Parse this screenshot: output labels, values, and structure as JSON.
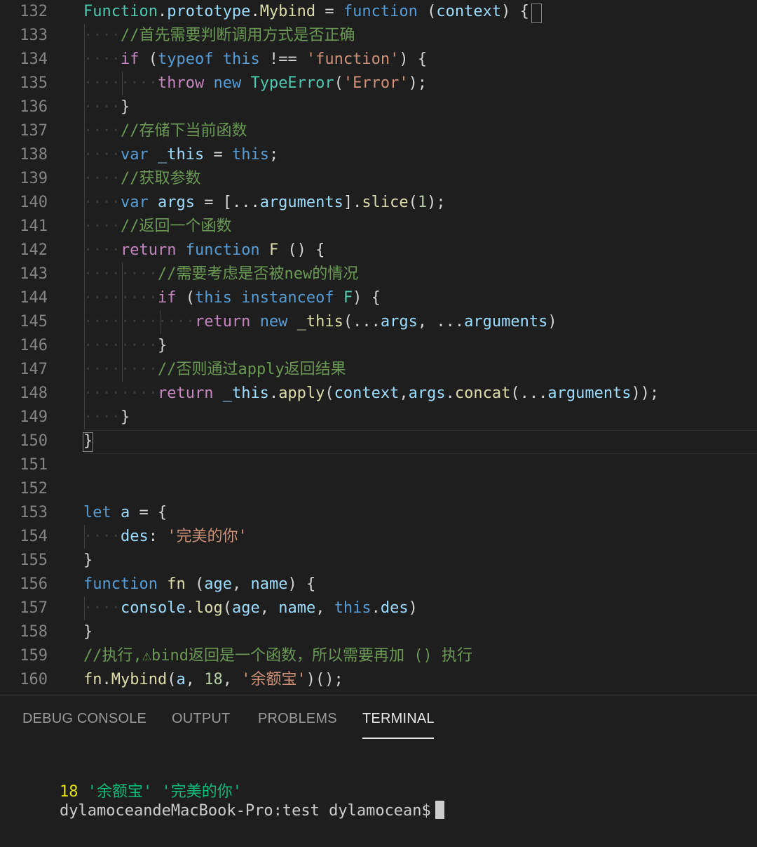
{
  "editor": {
    "lines": [
      {
        "n": "132",
        "tokens": [
          [
            "Function",
            "t-cls"
          ],
          [
            ".",
            "t-op"
          ],
          [
            "prototype",
            "t-var"
          ],
          [
            ".",
            "t-op"
          ],
          [
            "Mybind",
            "t-fn"
          ],
          [
            " = ",
            "t-op"
          ],
          [
            "function",
            "t-kw"
          ],
          [
            " (",
            "t-op"
          ],
          [
            "context",
            "t-var"
          ],
          [
            ") ",
            "t-op"
          ],
          [
            "{",
            "t-op"
          ]
        ]
      },
      {
        "n": "133",
        "tokens": [
          [
            "····",
            "ws"
          ],
          [
            "//首先需要判断调用方式是否正确",
            "t-com"
          ]
        ]
      },
      {
        "n": "134",
        "tokens": [
          [
            "····",
            "ws"
          ],
          [
            "if",
            "t-ctl"
          ],
          [
            " (",
            "t-op"
          ],
          [
            "typeof",
            "t-kw"
          ],
          [
            " ",
            "t-op"
          ],
          [
            "this",
            "t-kw"
          ],
          [
            " !== ",
            "t-op"
          ],
          [
            "'function'",
            "t-str"
          ],
          [
            ") {",
            "t-op"
          ]
        ]
      },
      {
        "n": "135",
        "tokens": [
          [
            "········",
            "ws"
          ],
          [
            "throw",
            "t-ctl"
          ],
          [
            " ",
            "t-op"
          ],
          [
            "new",
            "t-kw"
          ],
          [
            " ",
            "t-op"
          ],
          [
            "TypeError",
            "t-cls"
          ],
          [
            "(",
            "t-op"
          ],
          [
            "'Error'",
            "t-str"
          ],
          [
            ");",
            "t-op"
          ]
        ]
      },
      {
        "n": "136",
        "tokens": [
          [
            "····",
            "ws"
          ],
          [
            "}",
            "t-op"
          ]
        ]
      },
      {
        "n": "137",
        "tokens": [
          [
            "····",
            "ws"
          ],
          [
            "//存储下当前函数",
            "t-com"
          ]
        ]
      },
      {
        "n": "138",
        "tokens": [
          [
            "····",
            "ws"
          ],
          [
            "var",
            "t-kw"
          ],
          [
            " ",
            "t-op"
          ],
          [
            "_this",
            "t-var"
          ],
          [
            " = ",
            "t-op"
          ],
          [
            "this",
            "t-kw"
          ],
          [
            ";",
            "t-op"
          ]
        ]
      },
      {
        "n": "139",
        "tokens": [
          [
            "····",
            "ws"
          ],
          [
            "//获取参数",
            "t-com"
          ]
        ]
      },
      {
        "n": "140",
        "tokens": [
          [
            "····",
            "ws"
          ],
          [
            "var",
            "t-kw"
          ],
          [
            " ",
            "t-op"
          ],
          [
            "args",
            "t-var"
          ],
          [
            " = [...",
            "t-op"
          ],
          [
            "arguments",
            "t-var"
          ],
          [
            "].",
            "t-op"
          ],
          [
            "slice",
            "t-fn"
          ],
          [
            "(",
            "t-op"
          ],
          [
            "1",
            "t-num"
          ],
          [
            ");",
            "t-op"
          ]
        ]
      },
      {
        "n": "141",
        "tokens": [
          [
            "····",
            "ws"
          ],
          [
            "//返回一个函数",
            "t-com"
          ]
        ]
      },
      {
        "n": "142",
        "tokens": [
          [
            "····",
            "ws"
          ],
          [
            "return",
            "t-ctl"
          ],
          [
            " ",
            "t-op"
          ],
          [
            "function",
            "t-kw"
          ],
          [
            " ",
            "t-op"
          ],
          [
            "F",
            "t-fn"
          ],
          [
            " () {",
            "t-op"
          ]
        ]
      },
      {
        "n": "143",
        "tokens": [
          [
            "········",
            "ws"
          ],
          [
            "//需要考虑是否被new的情况",
            "t-com"
          ]
        ]
      },
      {
        "n": "144",
        "tokens": [
          [
            "········",
            "ws"
          ],
          [
            "if",
            "t-ctl"
          ],
          [
            " (",
            "t-op"
          ],
          [
            "this",
            "t-kw"
          ],
          [
            " ",
            "t-op"
          ],
          [
            "instanceof",
            "t-kw"
          ],
          [
            " ",
            "t-op"
          ],
          [
            "F",
            "t-cls"
          ],
          [
            ") {",
            "t-op"
          ]
        ]
      },
      {
        "n": "145",
        "tokens": [
          [
            "············",
            "ws"
          ],
          [
            "return",
            "t-ctl"
          ],
          [
            " ",
            "t-op"
          ],
          [
            "new",
            "t-kw"
          ],
          [
            " ",
            "t-op"
          ],
          [
            "_this",
            "t-fn"
          ],
          [
            "(...",
            "t-op"
          ],
          [
            "args",
            "t-var"
          ],
          [
            ", ...",
            "t-op"
          ],
          [
            "arguments",
            "t-var"
          ],
          [
            ")",
            "t-op"
          ]
        ]
      },
      {
        "n": "146",
        "tokens": [
          [
            "········",
            "ws"
          ],
          [
            "}",
            "t-op"
          ]
        ]
      },
      {
        "n": "147",
        "tokens": [
          [
            "········",
            "ws"
          ],
          [
            "//否则通过apply返回结果",
            "t-com"
          ]
        ]
      },
      {
        "n": "148",
        "tokens": [
          [
            "········",
            "ws"
          ],
          [
            "return",
            "t-ctl"
          ],
          [
            " ",
            "t-op"
          ],
          [
            "_this",
            "t-var"
          ],
          [
            ".",
            "t-op"
          ],
          [
            "apply",
            "t-fn"
          ],
          [
            "(",
            "t-op"
          ],
          [
            "context",
            "t-var"
          ],
          [
            ",",
            "t-op"
          ],
          [
            "args",
            "t-var"
          ],
          [
            ".",
            "t-op"
          ],
          [
            "concat",
            "t-fn"
          ],
          [
            "(...",
            "t-op"
          ],
          [
            "arguments",
            "t-var"
          ],
          [
            "));",
            "t-op"
          ]
        ]
      },
      {
        "n": "149",
        "tokens": [
          [
            "····",
            "ws"
          ],
          [
            "}",
            "t-op"
          ]
        ]
      },
      {
        "n": "150",
        "tokens": [
          [
            "}",
            "t-op"
          ]
        ]
      },
      {
        "n": "151",
        "tokens": []
      },
      {
        "n": "152",
        "tokens": []
      },
      {
        "n": "153",
        "tokens": [
          [
            "let",
            "t-kw"
          ],
          [
            " ",
            "t-op"
          ],
          [
            "a",
            "t-var"
          ],
          [
            " = {",
            "t-op"
          ]
        ]
      },
      {
        "n": "154",
        "tokens": [
          [
            "····",
            "ws"
          ],
          [
            "des",
            "t-var"
          ],
          [
            ": ",
            "t-op"
          ],
          [
            "'完美的你'",
            "t-str"
          ]
        ]
      },
      {
        "n": "155",
        "tokens": [
          [
            "}",
            "t-op"
          ]
        ]
      },
      {
        "n": "156",
        "tokens": [
          [
            "function",
            "t-kw"
          ],
          [
            " ",
            "t-op"
          ],
          [
            "fn",
            "t-fn"
          ],
          [
            " (",
            "t-op"
          ],
          [
            "age",
            "t-var"
          ],
          [
            ", ",
            "t-op"
          ],
          [
            "name",
            "t-var"
          ],
          [
            ") {",
            "t-op"
          ]
        ]
      },
      {
        "n": "157",
        "tokens": [
          [
            "····",
            "ws"
          ],
          [
            "console",
            "t-var"
          ],
          [
            ".",
            "t-op"
          ],
          [
            "log",
            "t-fn"
          ],
          [
            "(",
            "t-op"
          ],
          [
            "age",
            "t-var"
          ],
          [
            ", ",
            "t-op"
          ],
          [
            "name",
            "t-var"
          ],
          [
            ", ",
            "t-op"
          ],
          [
            "this",
            "t-kw"
          ],
          [
            ".",
            "t-op"
          ],
          [
            "des",
            "t-var"
          ],
          [
            ")",
            "t-op"
          ]
        ]
      },
      {
        "n": "158",
        "tokens": [
          [
            "}",
            "t-op"
          ]
        ]
      },
      {
        "n": "159",
        "tokens": [
          [
            "//执行,⚠bind返回是一个函数，所以需要再加 () 执行",
            "t-com"
          ]
        ]
      },
      {
        "n": "160",
        "tokens": [
          [
            "fn",
            "t-fn"
          ],
          [
            ".",
            "t-op"
          ],
          [
            "Mybind",
            "t-fn"
          ],
          [
            "(",
            "t-op"
          ],
          [
            "a",
            "t-var"
          ],
          [
            ", ",
            "t-op"
          ],
          [
            "18",
            "t-num"
          ],
          [
            ", ",
            "t-op"
          ],
          [
            "'余额宝'",
            "t-str"
          ],
          [
            ")();",
            "t-op"
          ]
        ]
      }
    ]
  },
  "panel": {
    "tabs": [
      {
        "label": "DEBUG CONSOLE",
        "active": false
      },
      {
        "label": "OUTPUT",
        "active": false
      },
      {
        "label": "PROBLEMS",
        "active": false
      },
      {
        "label": "TERMINAL",
        "active": true
      }
    ]
  },
  "terminal": {
    "output_num": "18",
    "output_str1": "'余额宝'",
    "output_str2": "'完美的你'",
    "prompt": "dylamoceandeMacBook-Pro:test dylamocean$"
  },
  "colors": {
    "background": "#1e1e1e",
    "keyword": "#569cd6",
    "control": "#c586c0",
    "function": "#dcdcaa",
    "variable": "#9cdcfe",
    "string": "#ce9178",
    "comment": "#6a9955",
    "terminal_yellow": "#e5e510",
    "terminal_green": "#0dbc79"
  }
}
